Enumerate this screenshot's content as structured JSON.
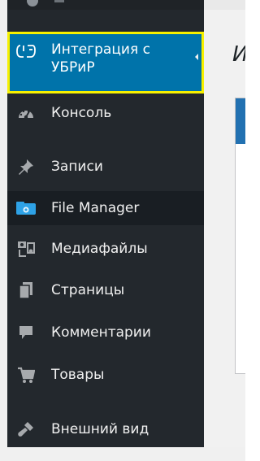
{
  "sidebar": {
    "items": [
      {
        "label": "Интеграция с\nУБРиР",
        "icon": "integration-icon",
        "active": true
      },
      {
        "label": "Консоль",
        "icon": "dashboard-icon"
      },
      {
        "label": "Записи",
        "icon": "pin-icon"
      },
      {
        "label": "File Manager",
        "icon": "file-manager-icon"
      },
      {
        "label": "Медиафайлы",
        "icon": "media-icon"
      },
      {
        "label": "Страницы",
        "icon": "pages-icon"
      },
      {
        "label": "Комментарии",
        "icon": "comments-icon"
      },
      {
        "label": "Товары",
        "icon": "cart-icon"
      },
      {
        "label": "Внешний вид",
        "icon": "appearance-icon"
      }
    ]
  },
  "main": {
    "title_fragment": "И"
  },
  "colors": {
    "sidebar_bg": "#23282d",
    "active_bg": "#0073aa",
    "highlight_border": "#f7f000",
    "text": "#f0f0f0",
    "icon": "#a7aaad"
  }
}
